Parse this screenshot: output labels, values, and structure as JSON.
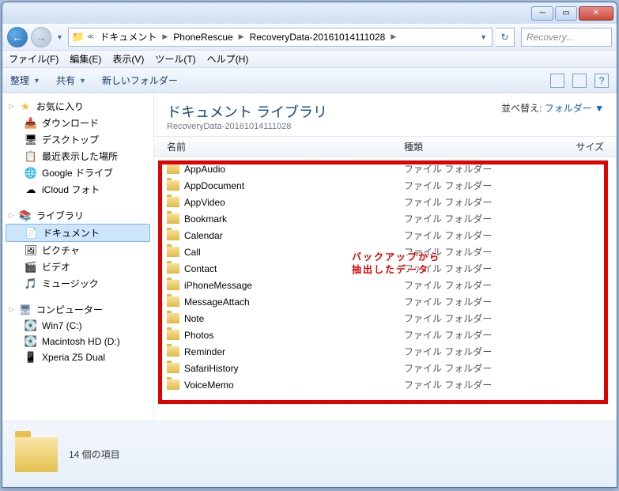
{
  "breadcrumb": {
    "root": "ドキュメント",
    "mid": "PhoneRescue",
    "leaf": "RecoveryData-20161014111028"
  },
  "search": {
    "placeholder": "Recovery..."
  },
  "menubar": {
    "file": "ファイル(F)",
    "edit": "編集(E)",
    "view": "表示(V)",
    "tools": "ツール(T)",
    "help": "ヘルプ(H)"
  },
  "toolbar": {
    "organize": "整理",
    "share": "共有",
    "newfolder": "新しいフォルダー"
  },
  "sidebar": {
    "favorites": {
      "label": "お気に入り",
      "items": [
        "ダウンロード",
        "デスクトップ",
        "最近表示した場所",
        "Google ドライブ",
        "iCloud フォト"
      ]
    },
    "libraries": {
      "label": "ライブラリ",
      "items": [
        "ドキュメント",
        "ピクチャ",
        "ビデオ",
        "ミュージック"
      ]
    },
    "computer": {
      "label": "コンピューター",
      "items": [
        "Win7 (C:)",
        "Macintosh HD (D:)",
        "Xperia Z5 Dual"
      ]
    }
  },
  "library": {
    "title": "ドキュメント ライブラリ",
    "subtitle": "RecoveryData-20161014111028",
    "arrange_label": "並べ替え:",
    "arrange_value": "フォルダー"
  },
  "columns": {
    "name": "名前",
    "type": "種類",
    "size": "サイズ"
  },
  "type_label": "ファイル フォルダー",
  "folders": [
    "AppAudio",
    "AppDocument",
    "AppVideo",
    "Bookmark",
    "Calendar",
    "Call",
    "Contact",
    "iPhoneMessage",
    "MessageAttach",
    "Note",
    "Photos",
    "Reminder",
    "SafariHistory",
    "VoiceMemo"
  ],
  "overlay": {
    "line1": "バックアップから",
    "line2": "抽出したデータ"
  },
  "status": {
    "count": "14 個の項目"
  }
}
